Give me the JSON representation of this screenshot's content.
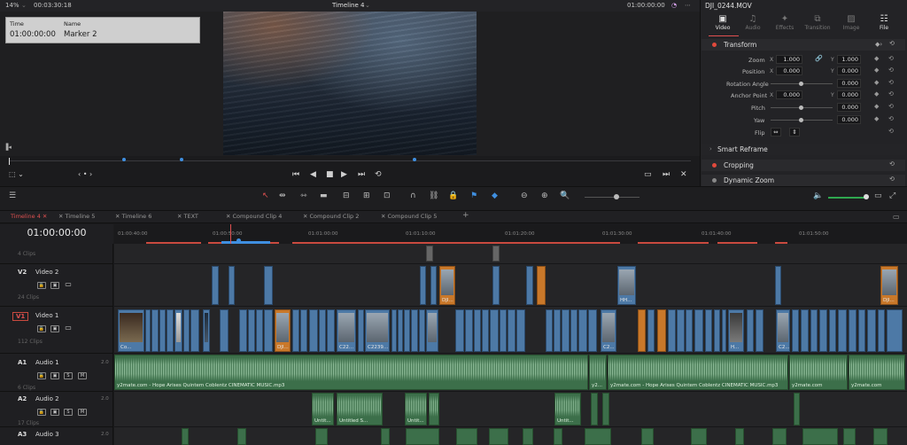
{
  "viewer": {
    "zoom": "14%",
    "source_timecode": "00:03:30:18",
    "timeline_name": "Timeline 4",
    "record_timecode": "01:00:00:00",
    "marker": {
      "time_label": "Time",
      "name_label": "Name",
      "time_value": "01:00:00:00",
      "name_value": "Marker 2"
    }
  },
  "inspector": {
    "clip_name": "DJI_0244.MOV",
    "tabs": [
      {
        "label": "Video",
        "icon": "video-icon"
      },
      {
        "label": "Audio",
        "icon": "audio-icon"
      },
      {
        "label": "Effects",
        "icon": "effects-icon"
      },
      {
        "label": "Transition",
        "icon": "transition-icon"
      },
      {
        "label": "Image",
        "icon": "image-icon"
      },
      {
        "label": "File",
        "icon": "file-icon"
      }
    ],
    "sections": {
      "transform": "Transform",
      "smart_reframe": "Smart Reframe",
      "cropping": "Cropping",
      "dynamic_zoom": "Dynamic Zoom"
    },
    "props": {
      "zoom": "Zoom",
      "position": "Position",
      "rotation": "Rotation Angle",
      "anchor": "Anchor Point",
      "pitch": "Pitch",
      "yaw": "Yaw",
      "flip": "Flip"
    },
    "values": {
      "zoom_x": "1.000",
      "zoom_y": "1.000",
      "pos_x": "0.000",
      "pos_y": "0.000",
      "rotation": "0.000",
      "anchor_x": "0.000",
      "anchor_y": "0.000",
      "pitch": "0.000",
      "yaw": "0.000"
    },
    "axis_x": "X",
    "axis_y": "Y"
  },
  "timeline": {
    "tabs": [
      "Timeline 4",
      "Timeline 5",
      "Timeline 6",
      "TEXT",
      "Compound Clip 4",
      "Compound Clip 2",
      "Compound Clip 5"
    ],
    "add_tab": "+",
    "timecode": "01:00:00:00",
    "ruler": [
      "01:00:40:00",
      "01:00:50:00",
      "01:01:00:00",
      "01:01:10:00",
      "01:01:20:00",
      "01:01:30:00",
      "01:01:40:00",
      "01:01:50:00"
    ],
    "tracks": {
      "v3_clips": "4 Clips",
      "v2": {
        "id": "V2",
        "name": "Video 2",
        "clips": "24 Clips"
      },
      "v1": {
        "id": "V1",
        "name": "Video 1",
        "clips": "112 Clips"
      },
      "a1": {
        "id": "A1",
        "name": "Audio 1",
        "clips": "6 Clips",
        "ch": "2.0"
      },
      "a2": {
        "id": "A2",
        "name": "Audio 2",
        "clips": "17 Clips",
        "ch": "2.0"
      },
      "a3": {
        "id": "A3",
        "name": "Audio 3",
        "ch": "2.0"
      }
    },
    "btn_s": "S",
    "btn_m": "M",
    "clip_labels": {
      "v2_a": "DJI...",
      "v2_b": "HH...",
      "v2_c": "DJI...",
      "v1_a": "Co...",
      "v1_b": "DJI...",
      "v1_c": "C22...",
      "v1_d": "C2239...",
      "v1_e": "C2...",
      "v1_f": "H...",
      "v1_g": "C2...",
      "a1_main": "y2mate.com - Hope Arises  Quintem Coblentz CINEMATIC MUSIC.mp3",
      "a1_short": "y2...",
      "a1_second": "y2mate.com - Hope Arises  Quintem Coblentz CINEMATIC MUSIC.mp3",
      "a1_third": "y2mate.com",
      "a1_fourth": "y2mate.com",
      "a2_a": "Untit...",
      "a2_b": "Untitled S...",
      "a2_c": "Untit...",
      "a2_d": "Untit..."
    }
  },
  "colors": {
    "accent": "#e05050",
    "video_clip": "#4d79a6",
    "audio_clip": "#3c6f4a",
    "orange_clip": "#c9782a"
  }
}
